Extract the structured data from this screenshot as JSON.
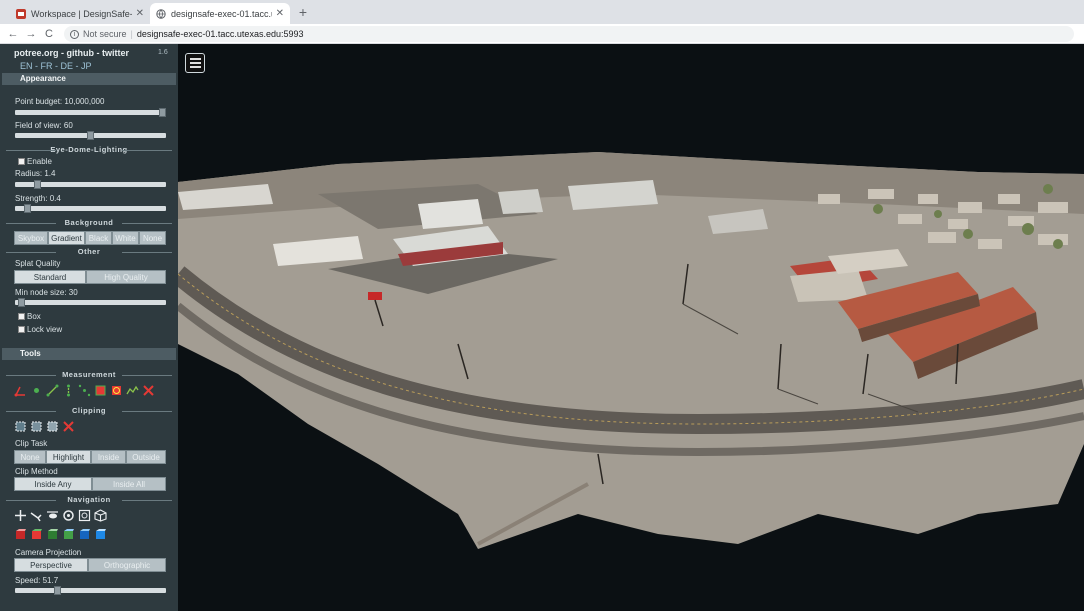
{
  "browser": {
    "tabs": [
      {
        "title": "Workspace | DesignSafe-CI",
        "active": false
      },
      {
        "title": "designsafe-exec-01.tacc.utexas.e",
        "active": true
      }
    ],
    "new_tab": "+",
    "nav": {
      "back": "←",
      "forward": "→",
      "reload": "C"
    },
    "security_label": "Not secure",
    "url": "designsafe-exec-01.tacc.utexas.edu:5993"
  },
  "sidebar": {
    "links": "potree.org - github - twitter",
    "version": "1.6",
    "languages": "EN - FR - DE - JP",
    "appearance": {
      "header": "Appearance",
      "point_budget_label": "Point budget: 10,000,000",
      "point_budget_fraction": 1.0,
      "fov_label": "Field of view: 60",
      "fov_fraction": 0.5,
      "edl_title": "Eye-Dome-Lighting",
      "enable_label": "Enable",
      "radius_label": "Radius: 1.4",
      "radius_fraction": 0.13,
      "strength_label": "Strength: 0.4",
      "strength_fraction": 0.06,
      "background_title": "Background",
      "background_options": [
        "Skybox",
        "Gradient",
        "Black",
        "White",
        "None"
      ],
      "background_selected": "Gradient",
      "other_title": "Other",
      "splat_label": "Splat Quality",
      "splat_options": [
        "Standard",
        "High Quality"
      ],
      "splat_selected": "Standard",
      "min_node_label": "Min node size: 30",
      "min_node_fraction": 0.02,
      "box_label": "Box",
      "lock_label": "Lock view"
    },
    "tools": {
      "header": "Tools",
      "measurement_title": "Measurement",
      "clipping_title": "Clipping",
      "clip_task_label": "Clip Task",
      "clip_task_options": [
        "None",
        "Highlight",
        "Inside",
        "Outside"
      ],
      "clip_task_selected": "Highlight",
      "clip_method_label": "Clip Method",
      "clip_method_options": [
        "Inside Any",
        "Inside All"
      ],
      "clip_method_selected": "Inside Any",
      "navigation_title": "Navigation",
      "camera_projection_label": "Camera Projection",
      "projection_options": [
        "Perspective",
        "Orthographic"
      ],
      "projection_selected": "Perspective",
      "speed_label": "Speed: 51.7",
      "speed_fraction": 0.27
    }
  },
  "colors": {
    "sidebar_bg": "#2e3a3f",
    "section_header": "#4d5c63",
    "viewport_bg": "#0b1013"
  }
}
